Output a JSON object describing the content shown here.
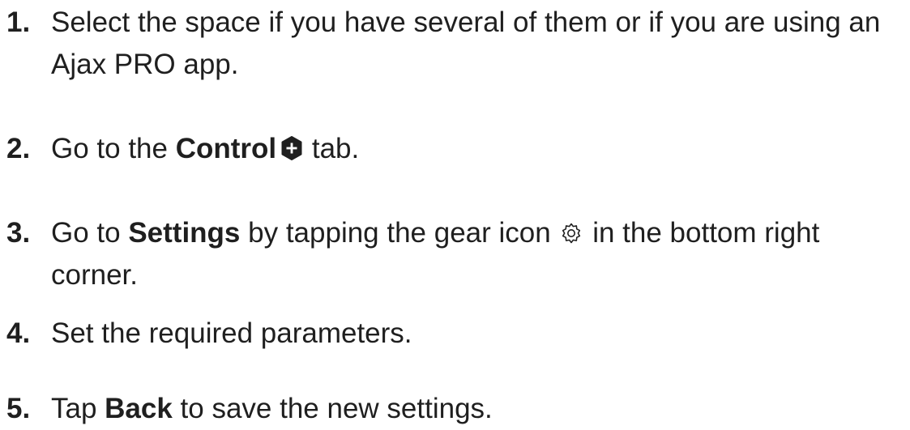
{
  "steps": [
    {
      "number": "1.",
      "text": "Select the space if you have several of them or if you are using an Ajax PRO app."
    },
    {
      "number": "2.",
      "pre": "Go to the ",
      "bold": "Control",
      "icon": "plus-badge-icon",
      "post": " tab."
    },
    {
      "number": "3.",
      "pre": "Go to ",
      "bold": "Settings",
      "mid": " by tapping the gear icon ",
      "icon": "gear-icon",
      "post": " in the bottom right corner."
    },
    {
      "number": "4.",
      "text": "Set the required parameters."
    },
    {
      "number": "5.",
      "pre": "Tap ",
      "bold": "Back",
      "post": " to save the new settings."
    }
  ],
  "colors": {
    "text": "#1f1f1f",
    "icon_fill": "#1f1f1f",
    "background": "#ffffff"
  }
}
